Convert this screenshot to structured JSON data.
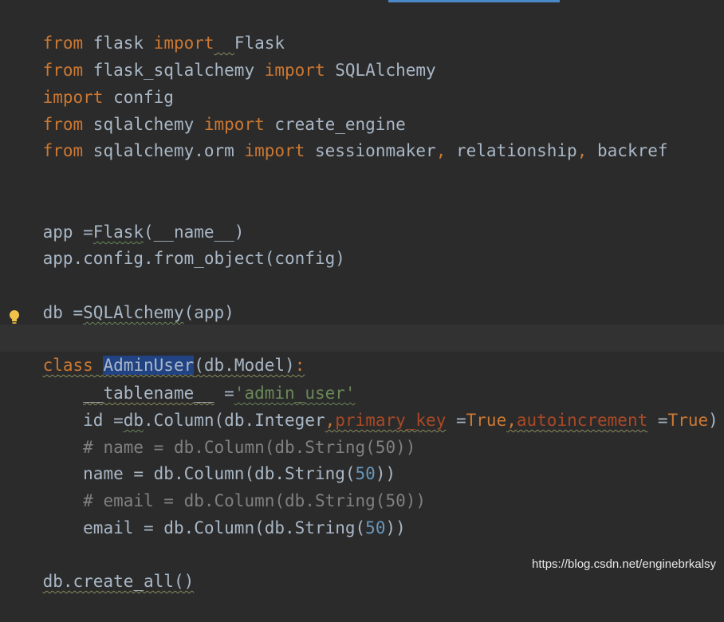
{
  "editor": {
    "lines": {
      "l1": {
        "kw1": "from",
        "mod": " flask ",
        "kw2": "import",
        "gap": "  ",
        "name": "Flask"
      },
      "l2": {
        "kw1": "from",
        "mod": " flask_sqlalchemy ",
        "kw2": "import",
        "name": " SQLAlchemy"
      },
      "l3": {
        "kw1": "import",
        "name": " config"
      },
      "l4": {
        "kw1": "from",
        "mod": " sqlalchemy ",
        "kw2": "import",
        "name": " create_engine"
      },
      "l5": {
        "kw1": "from",
        "mod": " sqlalchemy.orm ",
        "kw2": "import",
        "n1": " sessionmaker",
        "c1": ",",
        "n2": " relationship",
        "c2": ",",
        "n3": " backref"
      },
      "l6": {
        "a": "app =",
        "b": "Flask",
        "c": "(__name__)"
      },
      "l7": {
        "a": "app.config.from_object(config)"
      },
      "l8": {
        "a": "db =",
        "b": "SQLAlchemy",
        "c": "(app)"
      },
      "l9": {
        "kw": "class",
        "sp": " ",
        "cls": "AdminUser",
        "rest": "(db.Model)",
        "colon": ":"
      },
      "l10": {
        "indent": "    ",
        "a": "__tablename__",
        "b": " =",
        "s": "'admin_user'"
      },
      "l11": {
        "indent": "    ",
        "a": "id =",
        "b": "db",
        "c": ".Column(db.Integer",
        "d": ",",
        "p1": "primary_key",
        "e": " =",
        "t1": "True",
        "f": ",",
        "p2": "autoincrement",
        "g": " =",
        "t2": "True",
        "h": ")"
      },
      "l12": {
        "indent": "    ",
        "a": "# name = db.Column(db.String(50))"
      },
      "l13": {
        "indent": "    ",
        "a": "name = db.Column(db.String(",
        "n": "50",
        "b": "))"
      },
      "l14": {
        "indent": "    ",
        "a": "# email = db.Column(db.String(50))"
      },
      "l15": {
        "indent": "    ",
        "a": "email = db.Column(db.String(",
        "n": "50",
        "b": "))"
      },
      "l16": {
        "a": "db.create_all()"
      }
    }
  },
  "watermark": "https://blog.csdn.net/enginebrkalsy",
  "colors": {
    "background": "#2b2b2b",
    "keyword": "#cc7832",
    "text": "#a9b7c6",
    "string": "#6a8759",
    "number": "#6897bb",
    "comment": "#808080",
    "param": "#aa4926",
    "selection": "#214283"
  },
  "icons": {
    "gutter": "lightbulb-icon"
  }
}
